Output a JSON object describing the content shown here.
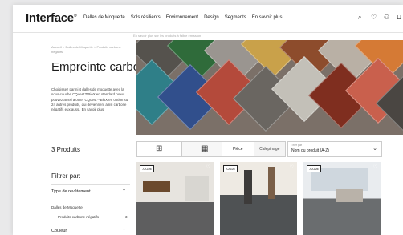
{
  "header": {
    "logo": "Interface",
    "nav": [
      "Dalles de Moquette",
      "Sols résilients",
      "Environnement",
      "Design",
      "Segments",
      "En savoir plus"
    ],
    "subtitle": "En savoir plus sur les produits à faible émission"
  },
  "breadcrumb": "Accueil > Dalles de Moquette > Produits carbone négatifs",
  "page": {
    "title": "Empreinte carbone négative",
    "description": "Choisissez parmi 4 dalles de moquette avec la sous-couche CQuest™BioX en standard. Vous pouvez aussi ajouter CQuest™BioX en option sur 24 autres produits, qui deviennent ainsi carbone négatifs eux aussi. En savoir plus"
  },
  "results": {
    "count_label": "3 Produits",
    "toggle": [
      "Pièce",
      "Calepinage"
    ],
    "sort_label": "Trier par",
    "sort_value": "Nom du produit (A-Z)"
  },
  "filters": {
    "title": "Filtrer par:",
    "groups": [
      {
        "label": "Type de revêtement",
        "expanded": true
      },
      {
        "label": "Couleur",
        "expanded": true
      }
    ],
    "items": [
      {
        "label": "Dalles de Moquette",
        "count": ""
      },
      {
        "label": "Produits carbone négatifs",
        "count": "3"
      }
    ]
  },
  "cards": [
    {
      "badge": "-CO2E",
      "heart": "♡"
    },
    {
      "badge": "-CO2E",
      "heart": "♡"
    },
    {
      "badge": "-CO2E",
      "heart": "♡"
    }
  ],
  "colors": {
    "accent": "#1e1e1e",
    "border": "#cccccc"
  }
}
